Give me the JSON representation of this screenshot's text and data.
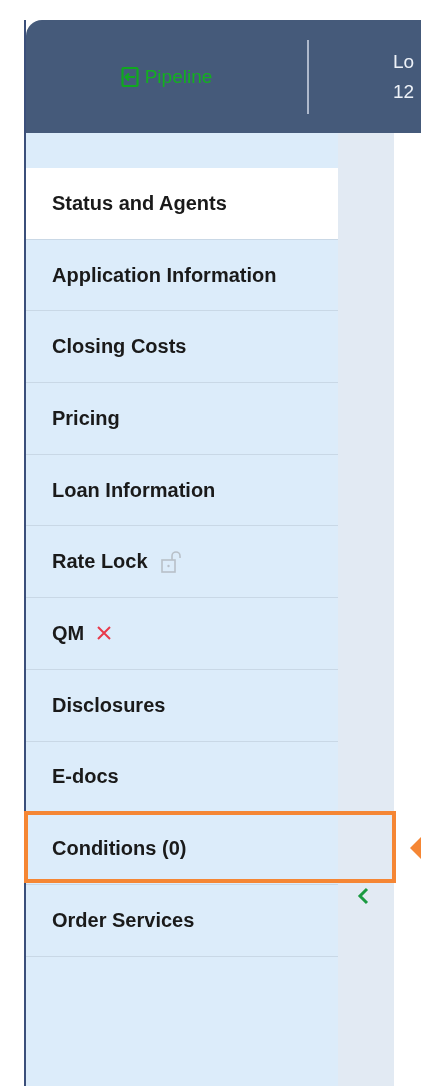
{
  "header": {
    "pipeline_link": "Pipeline",
    "loan_label": "Lo",
    "loan_number": "12"
  },
  "sidebar": {
    "items": [
      {
        "label": "Status and Agents",
        "selected": true
      },
      {
        "label": "Application Information",
        "selected": false
      },
      {
        "label": "Closing Costs",
        "selected": false
      },
      {
        "label": "Pricing",
        "selected": false
      },
      {
        "label": "Loan Information",
        "selected": false
      },
      {
        "label": "Rate Lock",
        "selected": false,
        "kind": "lock"
      },
      {
        "label": "QM",
        "selected": false,
        "kind": "error"
      },
      {
        "label": "Disclosures",
        "selected": false
      },
      {
        "label": "E-docs",
        "selected": false
      },
      {
        "label": "Conditions (0)",
        "selected": false,
        "highlighted": true
      },
      {
        "label": "Order Services",
        "selected": false
      }
    ]
  }
}
